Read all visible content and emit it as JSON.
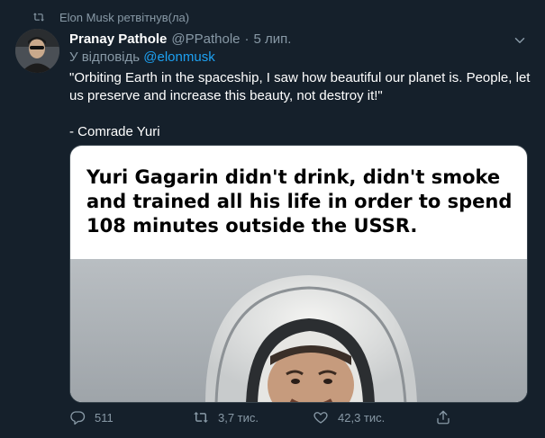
{
  "retweet_context": {
    "text": "Elon Musk ретвітнув(ла)"
  },
  "tweet": {
    "author_name": "Pranay Pathole",
    "handle": "@PPathole",
    "separator": "·",
    "timestamp": "5 лип.",
    "reply_prefix": "У відповідь",
    "reply_mention": "@elonmusk",
    "body_quote": "\"Orbiting Earth in the spaceship, I saw how beautiful our planet is. People, let us preserve and increase this beauty, not destroy it!\"",
    "body_attribution": "- Comrade Yuri"
  },
  "media": {
    "caption": "Yuri Gagarin didn't drink, didn't smoke and trained all his life  in order to spend 108 minutes outside the USSR."
  },
  "actions": {
    "replies": "511",
    "retweets": "3,7 тис.",
    "likes": "42,3 тис."
  },
  "icons": {
    "retweet": "retweet-icon",
    "caret": "chevron-down-icon",
    "reply": "reply-icon",
    "like": "heart-icon",
    "share": "share-icon"
  },
  "colors": {
    "background": "#15202b",
    "muted": "#8899a6",
    "link": "#1da1f2",
    "border": "#38444d"
  }
}
